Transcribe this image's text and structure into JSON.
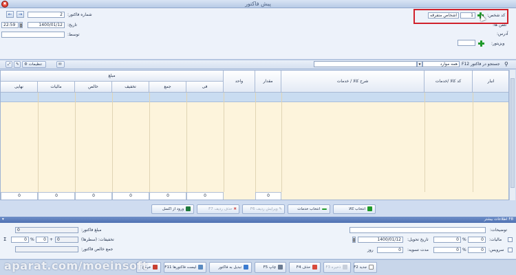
{
  "window": {
    "title": "پیش فاکتور",
    "close_glyph": "✖"
  },
  "header": {
    "invoice_no_label": "شماره فاکتور:",
    "invoice_no_value": "2",
    "date_label": "تاریخ:",
    "date_value": "1400/01/12",
    "time_value": "22:59",
    "by_label": "توسط:",
    "by_value": "",
    "person_code_label": "کد شخص:",
    "person_code_value": "1",
    "person_name_value": "اشخاص متفرقه",
    "phone_label": "تلفن ها:",
    "address_label": "آدرس:",
    "visitor_label": "ویزیتور:",
    "visitor_value": ""
  },
  "toolbar": {
    "settings_label": "تنظیمات",
    "search_label": "جستجو در فاکتور F12",
    "search_value": "",
    "scope_value": "همه موارد"
  },
  "grid": {
    "columns": [
      "انبار",
      "کد کالا /خدمات",
      "شرح کالا / خدمات",
      "مقدار",
      "واحد",
      "فی",
      "جمع",
      "تخفیف",
      "خالص",
      "مالیات",
      "نهایی"
    ],
    "amount_group_label": "مبلغ",
    "totals": [
      "0",
      "0",
      "0",
      "0",
      "0",
      "0",
      "0"
    ]
  },
  "grid_buttons": {
    "select_goods": "انتخاب کالا",
    "select_services": "انتخاب خدمات",
    "edit_row": "ویرایش ردیف F6",
    "delete_row": "حذف ردیف F7",
    "import_excel": "ورود از اکسل"
  },
  "more_info": {
    "title": "F8 اطلاعات بیشتر",
    "description_label": "توضیحات:",
    "description_value": "",
    "tax_label": "مالیات:",
    "tax_percent": "0",
    "tax_amount": "0",
    "delivery_date_label": "تاریخ تحویل:",
    "delivery_date_value": "1400/01/12",
    "service_label": "سرویس:",
    "service_percent": "0",
    "service_amount": "0",
    "settlement_label": "مدت تسویه:",
    "settlement_value": "0",
    "days_label": "روز",
    "invoice_amount_label": "مبلغ فاکتور:",
    "invoice_amount_value": "0",
    "discounts_label": "تخفیفات: (سطرها)",
    "discounts_value": "0",
    "discount_percent": "0",
    "discount_amount": "0",
    "net_total_label": "جمع خالص فاکتور:",
    "net_total_value": "",
    "percent_sign": "%",
    "plus_sign": "+",
    "sigma": "Σ"
  },
  "bottom_buttons": {
    "new": "جدید F2",
    "save": "ذخیره F3",
    "delete": "حذف F4",
    "print": "چاپ F5",
    "convert": "تبدیل به فاکتور",
    "list": "لیست فاکتورها F11",
    "exit": "خروج"
  },
  "watermark": "aparat.com/moeinsoft",
  "colors": {
    "accent": "#4f71b2",
    "highlight_box": "#d0202a",
    "grid_bg": "#fdf4dc",
    "selected_row": "#c9dcf1"
  }
}
